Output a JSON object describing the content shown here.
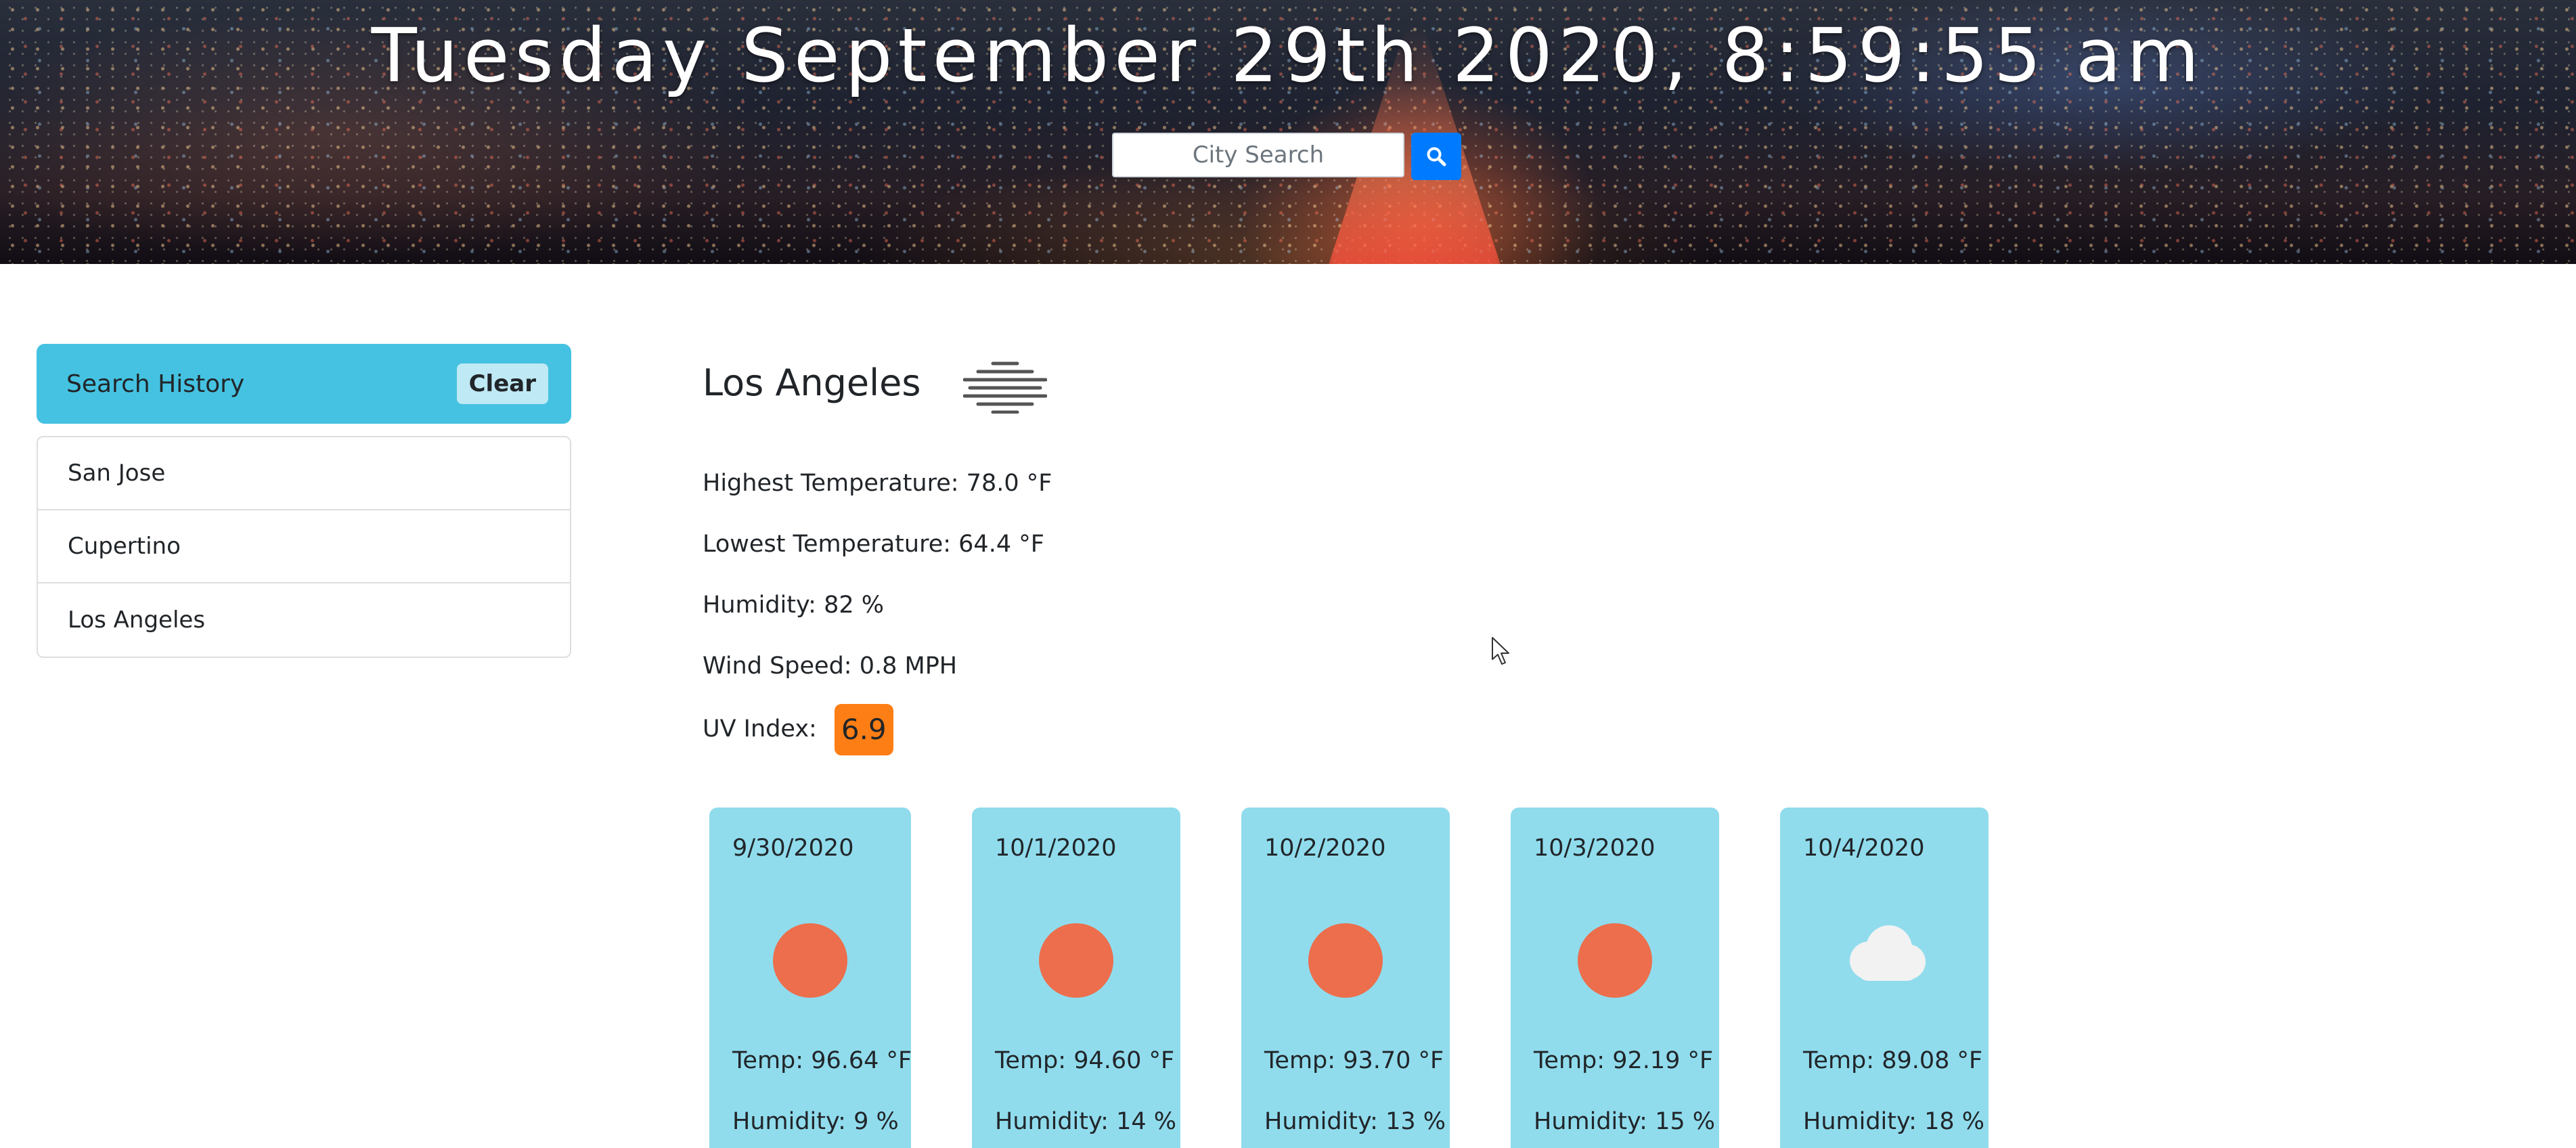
{
  "header": {
    "datetime": "Tuesday September 29th 2020, 8:59:55 am",
    "search": {
      "placeholder": "City Search",
      "value": "",
      "button_icon": "search-icon",
      "button_color": "#007bff"
    }
  },
  "sidebar": {
    "title": "Search History",
    "clear_label": "Clear",
    "header_color": "#45c2e1",
    "items": [
      {
        "label": "San Jose"
      },
      {
        "label": "Cupertino"
      },
      {
        "label": "Los Angeles"
      }
    ]
  },
  "current": {
    "city": "Los Angeles",
    "icon": "mist-icon",
    "high": "Highest Temperature: 78.0 °F",
    "low": "Lowest Temperature: 64.4 °F",
    "humidity": "Humidity: 82 %",
    "wind": "Wind Speed: 0.8 MPH",
    "uv_label": "UV Index:",
    "uv_value": "6.9",
    "uv_color": "#fd7e14"
  },
  "forecast": {
    "card_color": "#90dced",
    "days": [
      {
        "date": "9/30/2020",
        "icon": "sun-icon",
        "temp": "Temp: 96.64 °F",
        "humidity": "Humidity: 9 %"
      },
      {
        "date": "10/1/2020",
        "icon": "sun-icon",
        "temp": "Temp: 94.60 °F",
        "humidity": "Humidity: 14 %"
      },
      {
        "date": "10/2/2020",
        "icon": "sun-icon",
        "temp": "Temp: 93.70 °F",
        "humidity": "Humidity: 13 %"
      },
      {
        "date": "10/3/2020",
        "icon": "sun-icon",
        "temp": "Temp: 92.19 °F",
        "humidity": "Humidity: 15 %"
      },
      {
        "date": "10/4/2020",
        "icon": "cloud-icon",
        "temp": "Temp: 89.08 °F",
        "humidity": "Humidity: 18 %"
      }
    ]
  }
}
